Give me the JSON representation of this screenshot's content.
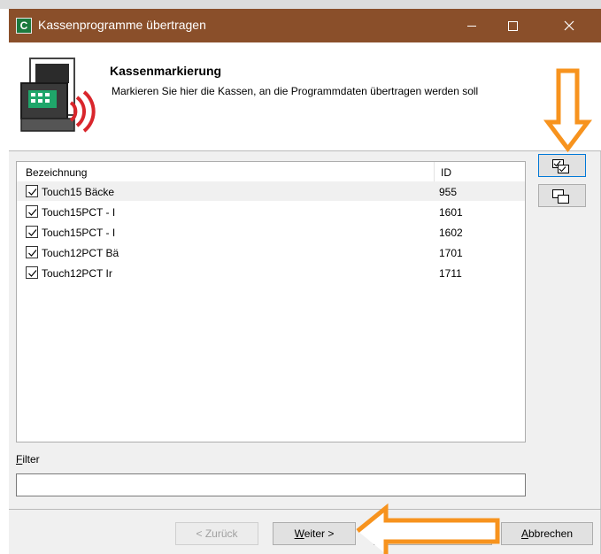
{
  "window": {
    "title": "Kassenprogramme übertragen",
    "app_icon_letter": "C"
  },
  "header": {
    "title": "Kassenmarkierung",
    "description": "Markieren Sie hier die Kassen, an die Programmdaten übertragen werden soll"
  },
  "list": {
    "columns": [
      "Bezeichnung",
      "ID"
    ],
    "rows": [
      {
        "name": "Touch15 Bäcke",
        "id": "955",
        "checked": true,
        "selected": true
      },
      {
        "name": "Touch15PCT - I",
        "id": "1601",
        "checked": true,
        "selected": false
      },
      {
        "name": "Touch15PCT - I",
        "id": "1602",
        "checked": true,
        "selected": false
      },
      {
        "name": "Touch12PCT Bä",
        "id": "1701",
        "checked": true,
        "selected": false
      },
      {
        "name": "Touch12PCT Ir",
        "id": "1711",
        "checked": true,
        "selected": false
      }
    ]
  },
  "side_buttons": {
    "check_all_icon": "check-all-icon",
    "uncheck_all_icon": "uncheck-all-icon"
  },
  "filter": {
    "label": "Filter",
    "value": ""
  },
  "buttons": {
    "back": "< Zurück",
    "next": "Weiter >",
    "cancel": "Abbrechen"
  },
  "colors": {
    "titlebar": "#8a4f2a",
    "annotation_arrows": "#f7931e"
  }
}
